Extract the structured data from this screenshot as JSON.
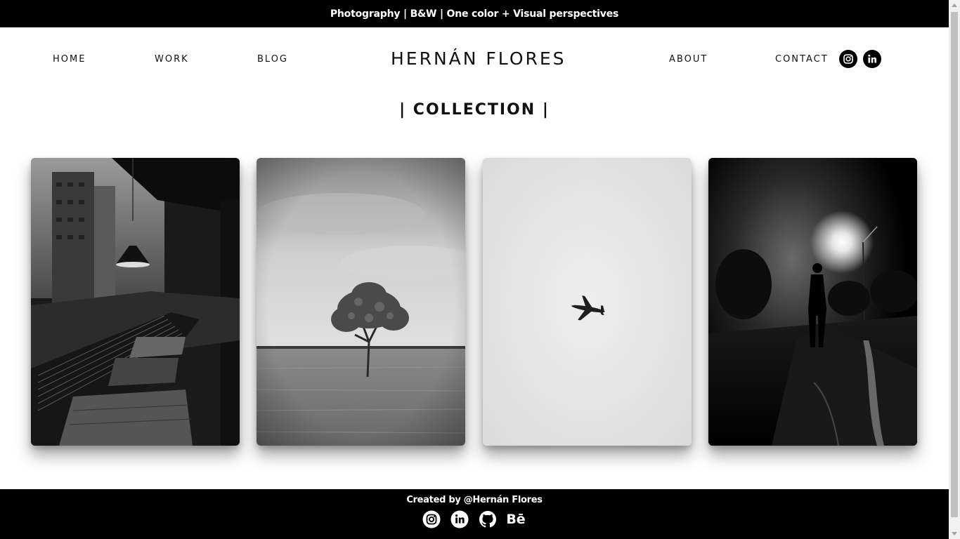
{
  "topbar": {
    "tagline": "Photography | B&W | One color + Visual perspectives"
  },
  "nav": {
    "home": "HOME",
    "work": "WORK",
    "blog": "BLOG",
    "brand": "HERNÁN FLORES",
    "about": "ABOUT",
    "contact": "CONTACT",
    "social": [
      "instagram-icon",
      "linkedin-icon"
    ]
  },
  "collection": {
    "title": "| COLLECTION |",
    "photos": [
      "cafe-interior-photo",
      "lone-tree-photo",
      "airplane-sky-photo",
      "night-street-silhouette-photo"
    ]
  },
  "footer": {
    "credit": "Created by @Hernán Flores",
    "behance_label": "Bē",
    "social": [
      "instagram-icon",
      "linkedin-icon",
      "github-icon",
      "behance-icon"
    ]
  },
  "colors": {
    "bar": "#000000",
    "text": "#111111",
    "background": "#ffffff"
  }
}
